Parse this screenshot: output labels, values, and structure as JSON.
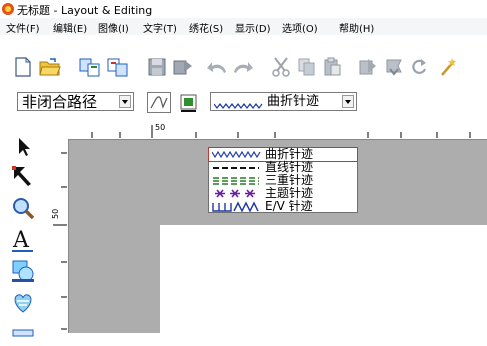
{
  "window": {
    "title": "无标题 - Layout & Editing"
  },
  "menu": [
    {
      "label": "文件(F)"
    },
    {
      "label": "编辑(E)"
    },
    {
      "label": "图像(I)"
    },
    {
      "label": "文字(T)"
    },
    {
      "label": "绣花(S)"
    },
    {
      "label": "显示(D)"
    },
    {
      "label": "选项(O)"
    },
    {
      "label": "帮助(H)"
    }
  ],
  "toolbar": {
    "path_type": "非闭合路径",
    "stitch_type": "曲折针迹"
  },
  "ruler": {
    "unit": "mm",
    "top_label": "50",
    "left_label": "50"
  },
  "stitch_dropdown": {
    "items": [
      {
        "label": "曲折针迹",
        "sample": "zigzag"
      },
      {
        "label": "直线针迹",
        "sample": "running"
      },
      {
        "label": "三重针迹",
        "sample": "triple"
      },
      {
        "label": "主题针迹",
        "sample": "motif"
      },
      {
        "label": "E/V 针迹",
        "sample": "ev"
      }
    ],
    "selected": "曲折针迹"
  },
  "colors": {
    "canvas_bg": "#adadad",
    "accent_blue": "#1f5fbf",
    "stitch_blue": "#1d39a8",
    "triple_green": "#2a7d2a",
    "motif_purple": "#6a1fa0",
    "selection_red": "#c0392b"
  }
}
